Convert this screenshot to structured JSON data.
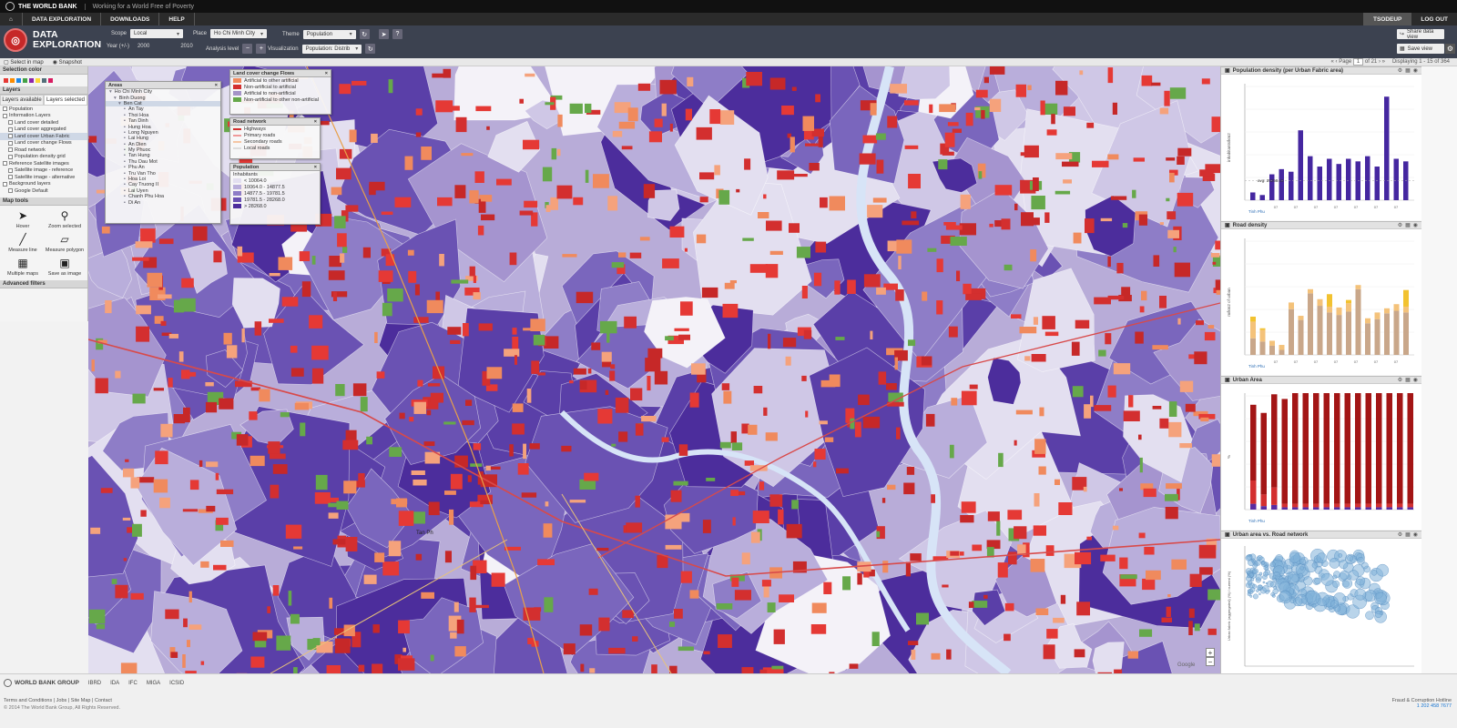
{
  "topbar": {
    "org": "THE WORLD BANK",
    "tagline": "Working for a World Free of Poverty"
  },
  "nav": {
    "items": [
      "DATA EXPLORATION",
      "DOWNLOADS",
      "HELP"
    ],
    "right": [
      "TSODEUP",
      "LOG OUT"
    ]
  },
  "header": {
    "title": "DATA EXPLORATION",
    "scope_label": "Scope",
    "scope_value": "Local",
    "year_label": "Year (+/-)",
    "year_from": "2000",
    "year_to": "2010",
    "place_label": "Place",
    "place_value": "Ho Chi Minh City",
    "analysis_label": "Analysis level",
    "theme_label": "Theme",
    "theme_value": "Population",
    "visualization_label": "Visualization",
    "visualization_value": "Population: Distrib",
    "share_label": "Share data view",
    "save_label": "Save view"
  },
  "toolstrip": {
    "select_label": "Select in map",
    "snapshot_label": "Snapshot",
    "page_label": "Page",
    "page_value": "1",
    "of_label": "of 21",
    "displaying": "Displaying 1 - 15 of 364"
  },
  "left": {
    "selection_color": "Selection color",
    "swatch_colors": [
      "#e53935",
      "#fb8c00",
      "#1e88e5",
      "#43a047",
      "#8e24aa",
      "#fdd835",
      "#546e7a",
      "#d81b60"
    ],
    "layers_title": "Layers",
    "tab_available": "Layers available",
    "tab_selected": "Layers selected",
    "layers": [
      "Population",
      "Information Layers",
      "Land cover detailed",
      "Land cover aggregated",
      "Land cover Urban Fabric",
      "Land cover change Flows",
      "Road network",
      "Population density grid",
      "Reference Satellite images",
      "Satellite image - reference",
      "Satellite image - alternative",
      "Background layers",
      "Google Default"
    ],
    "map_tools_title": "Map tools",
    "tools": [
      "Hover",
      "Zoom selected",
      "Measure line",
      "Measure polygon",
      "Multiple maps",
      "Save as image"
    ],
    "advanced_filters": "Advanced filters"
  },
  "areas_panel": {
    "title": "Areas",
    "items": [
      "Ho Chi Minh City",
      "Binh Duong",
      "Ben Cat",
      "An Tay",
      "Thoi Hoa",
      "Tan Dinh",
      "Hung Hoa",
      "Long Nguyen",
      "Lai Hung",
      "An Dien",
      "My Phuoc",
      "Tan Hung",
      "Thu Dau Mot",
      "Phu An",
      "Tru Van Tho",
      "Hoa Loi",
      "Cay Truong II",
      "Lai Uyen",
      "Chanh Phu Hoa",
      "Di An"
    ]
  },
  "lcc_panel": {
    "title": "Land cover change Flows",
    "items": [
      {
        "label": "Artificial to other artificial",
        "color": "#f08a5d"
      },
      {
        "label": "Non-artificial to artificial",
        "color": "#d32f2f"
      },
      {
        "label": "Artificial to non-artificial",
        "color": "#a594c7"
      },
      {
        "label": "Non-artificial to other non-artificial",
        "color": "#66a84a"
      }
    ]
  },
  "road_panel": {
    "title": "Road network",
    "items": [
      "Highways",
      "Primary roads",
      "Secondary roads",
      "Local roads"
    ]
  },
  "pop_panel": {
    "title": "Population",
    "header": "Inhabitants",
    "items": [
      {
        "label": "< 10064.0",
        "color": "#e3dff0"
      },
      {
        "label": "10064.0 - 14877.5",
        "color": "#b9aedb"
      },
      {
        "label": "14877.5 - 19781.5",
        "color": "#8e7dc7"
      },
      {
        "label": "19781.5 - 28268.0",
        "color": "#6a52b3"
      },
      {
        "label": "> 28268.0",
        "color": "#4c2d9c"
      }
    ]
  },
  "map": {
    "place_labels": [
      "Tan Ph"
    ],
    "attribution": "Google",
    "zoom_in": "+",
    "zoom_out": "−"
  },
  "charts": [
    {
      "title": "Population density (per Urban Fabric area)",
      "ylabel": "inhabitants/km2",
      "annotation": "avg: 25258.15",
      "legend": "Tinh Phu",
      "x_ticks": [
        "07",
        "07",
        "07",
        "07",
        "07",
        "07",
        "07"
      ],
      "chart_data": {
        "type": "bar",
        "values": [
          3,
          2,
          10,
          12,
          11,
          27,
          17,
          13,
          16,
          14,
          16,
          15,
          17,
          13,
          40,
          16,
          15
        ],
        "ylim": [
          0,
          45
        ],
        "color": "#4527a0"
      }
    },
    {
      "title": "Road density",
      "ylabel": "m/km2 of urban",
      "legend": "Tinh Phu",
      "x_ticks": [
        "07",
        "07",
        "07",
        "07",
        "07",
        "07",
        "07"
      ],
      "chart_data": {
        "type": "bar",
        "series": [
          {
            "values": [
              20,
              16,
              11,
              6,
              55,
              42,
              74,
              59,
              51,
              48,
              52,
              79,
              38,
              43,
              50,
              53,
              51
            ],
            "color": "#c9a78a"
          },
          {
            "values": [
              20,
              14,
              6,
              6,
              8,
              5,
              5,
              8,
              7,
              9,
              10,
              5,
              6,
              8,
              6,
              8,
              7
            ],
            "color": "#f4c27a"
          },
          {
            "values": [
              6,
              2,
              0,
              0,
              0,
              0,
              0,
              0,
              15,
              0,
              4,
              0,
              0,
              0,
              0,
              0,
              20
            ],
            "color": "#f2c230"
          }
        ],
        "ylim": [
          0,
          140
        ]
      }
    },
    {
      "title": "Urban Area",
      "ylabel": "%",
      "legend": "Tinh Phu",
      "chart_data": {
        "type": "bar",
        "series": [
          {
            "values": [
              5,
              3,
              4,
              2,
              2,
              2,
              2,
              2,
              2,
              2,
              2,
              2,
              2,
              2,
              2,
              2
            ],
            "color": "#5a2ca0"
          },
          {
            "values": [
              20,
              10,
              15,
              3,
              3,
              3,
              3,
              3,
              3,
              3,
              3,
              3,
              3,
              3,
              3,
              3
            ],
            "color": "#d32f2f"
          },
          {
            "values": [
              65,
              70,
              80,
              90,
              95,
              95,
              95,
              95,
              95,
              95,
              95,
              95,
              95,
              95,
              95,
              95
            ],
            "color": "#a31515"
          }
        ],
        "ylim": [
          0,
          100
        ]
      }
    },
    {
      "title": "Urban area vs. Road network",
      "ylabel": "Urban fabric (aggregated) (%) / current (%)",
      "chart_data": {
        "type": "scatter",
        "color": "#7fb0d8"
      }
    }
  ],
  "footer": {
    "group": "WORLD BANK GROUP",
    "members": [
      "IBRD",
      "IDA",
      "IFC",
      "MIGA",
      "ICSID"
    ],
    "links": "Terms and Conditions | Jobs | Site Map | Contact",
    "copyright": "© 2014 The World Bank Group, All Rights Reserved.",
    "fraud": "Fraud & Corruption Hotline",
    "fraud_sub": "1 202 458 7677"
  }
}
